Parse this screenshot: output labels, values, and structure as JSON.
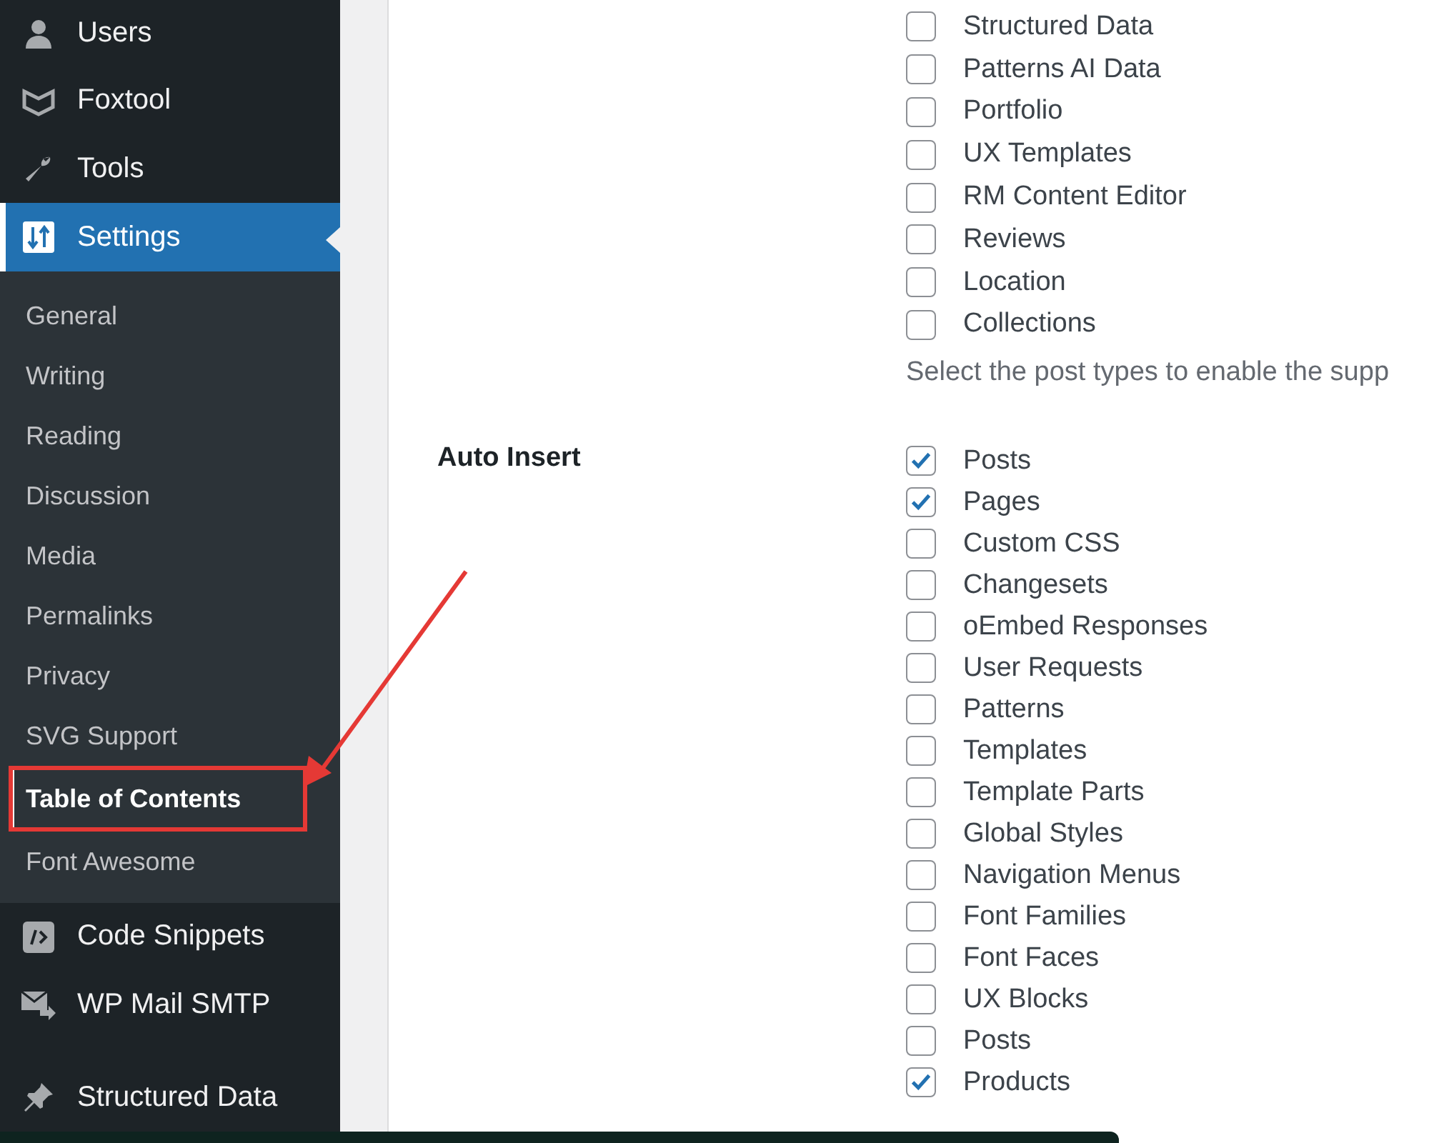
{
  "sidebar": {
    "top_items": [
      {
        "label": "Users",
        "selected": false
      },
      {
        "label": "Foxtool",
        "selected": false
      },
      {
        "label": "Tools",
        "selected": false
      },
      {
        "label": "Settings",
        "selected": true
      }
    ],
    "submenu": [
      {
        "label": "General",
        "selected": false,
        "highlighted": false
      },
      {
        "label": "Writing",
        "selected": false,
        "highlighted": false
      },
      {
        "label": "Reading",
        "selected": false,
        "highlighted": false
      },
      {
        "label": "Discussion",
        "selected": false,
        "highlighted": false
      },
      {
        "label": "Media",
        "selected": false,
        "highlighted": false
      },
      {
        "label": "Permalinks",
        "selected": false,
        "highlighted": false
      },
      {
        "label": "Privacy",
        "selected": false,
        "highlighted": false
      },
      {
        "label": "SVG Support",
        "selected": false,
        "highlighted": false
      },
      {
        "label": "Table of Contents",
        "selected": true,
        "highlighted": true
      },
      {
        "label": "Font Awesome",
        "selected": false,
        "highlighted": false
      }
    ],
    "bottom_items": [
      {
        "label": "Code Snippets",
        "selected": false
      },
      {
        "label": "WP Mail SMTP",
        "selected": false
      },
      {
        "label": "Structured Data",
        "selected": false
      }
    ]
  },
  "content": {
    "support_types": [
      {
        "label": "Structured Data",
        "checked": false
      },
      {
        "label": "Patterns AI Data",
        "checked": false
      },
      {
        "label": "Portfolio",
        "checked": false
      },
      {
        "label": "UX Templates",
        "checked": false
      },
      {
        "label": "RM Content Editor",
        "checked": false
      },
      {
        "label": "Reviews",
        "checked": false
      },
      {
        "label": "Location",
        "checked": false
      },
      {
        "label": "Collections",
        "checked": false
      }
    ],
    "support_description": "Select the post types to enable the supp",
    "auto_insert": {
      "label": "Auto Insert",
      "types": [
        {
          "label": "Posts",
          "checked": true
        },
        {
          "label": "Pages",
          "checked": true
        },
        {
          "label": "Custom CSS",
          "checked": false
        },
        {
          "label": "Changesets",
          "checked": false
        },
        {
          "label": "oEmbed Responses",
          "checked": false
        },
        {
          "label": "User Requests",
          "checked": false
        },
        {
          "label": "Patterns",
          "checked": false
        },
        {
          "label": "Templates",
          "checked": false
        },
        {
          "label": "Template Parts",
          "checked": false
        },
        {
          "label": "Global Styles",
          "checked": false
        },
        {
          "label": "Navigation Menus",
          "checked": false
        },
        {
          "label": "Font Families",
          "checked": false
        },
        {
          "label": "Font Faces",
          "checked": false
        },
        {
          "label": "UX Blocks",
          "checked": false
        },
        {
          "label": "Posts",
          "checked": false
        },
        {
          "label": "Products",
          "checked": true
        }
      ]
    }
  }
}
